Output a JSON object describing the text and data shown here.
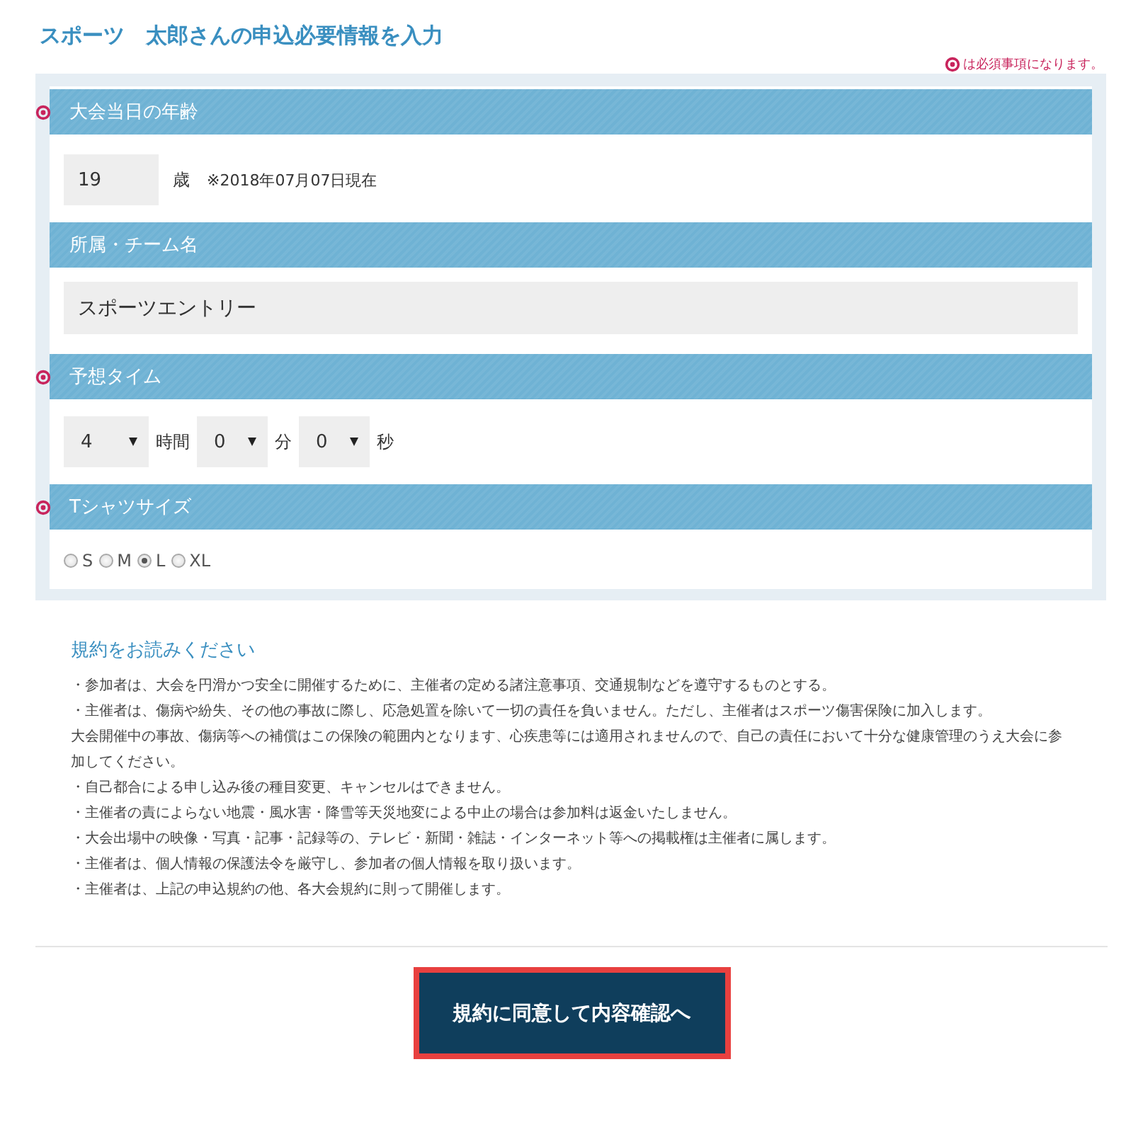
{
  "title": "スポーツ　太郎さんの申込必要情報を入力",
  "required_note": "は必須事項になります。",
  "sections": [
    {
      "title": "大会当日の年齢",
      "required": true,
      "kind": "age",
      "value": "19",
      "unit": "歳",
      "note": "※2018年07月07日現在"
    },
    {
      "title": "所属・チーム名",
      "required": false,
      "kind": "text",
      "value": "スポーツエントリー"
    },
    {
      "title": "予想タイム",
      "required": true,
      "kind": "time",
      "parts": [
        {
          "value": "4",
          "unit": "時間"
        },
        {
          "value": "0",
          "unit": "分"
        },
        {
          "value": "0",
          "unit": "秒"
        }
      ]
    },
    {
      "title": "Tシャツサイズ",
      "required": true,
      "kind": "radio",
      "options": [
        {
          "label": "S",
          "selected": false
        },
        {
          "label": "M",
          "selected": false
        },
        {
          "label": "L",
          "selected": true
        },
        {
          "label": "XL",
          "selected": false
        }
      ]
    }
  ],
  "terms": {
    "heading": "規約をお読みください",
    "paragraphs": [
      "・参加者は、大会を円滑かつ安全に開催するために、主催者の定める諸注意事項、交通規制などを遵守するものとする。",
      "・主催者は、傷病や紛失、その他の事故に際し、応急処置を除いて一切の責任を負いません。ただし、主催者はスポーツ傷害保険に加入します。",
      "大会開催中の事故、傷病等への補償はこの保険の範囲内となります、心疾患等には適用されませんので、自己の責任において十分な健康管理のうえ大会に参加してください。",
      "・自己都合による申し込み後の種目変更、キャンセルはできません。",
      "・主催者の責によらない地震・風水害・降雪等天災地変による中止の場合は参加料は返金いたしません。",
      "・大会出場中の映像・写真・記事・記録等の、テレビ・新聞・雑誌・インターネット等への掲載権は主催者に属します。",
      "・主催者は、個人情報の保護法令を厳守し、参加者の個人情報を取り扱います。",
      "・主催者は、上記の申込規約の他、各大会規約に則って開催します。"
    ]
  },
  "submit_button": "規約に同意して内容確認へ"
}
